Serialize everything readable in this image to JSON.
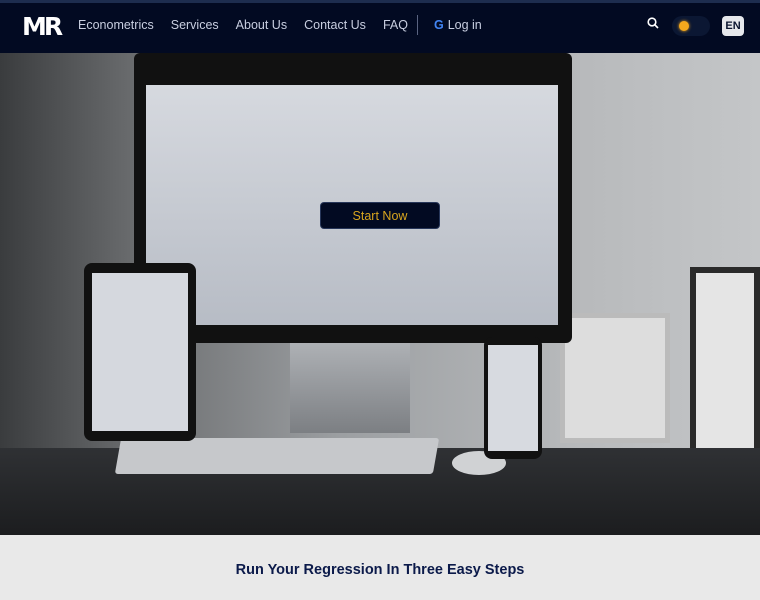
{
  "nav": {
    "logo": "MR",
    "links": [
      "Econometrics",
      "Services",
      "About Us",
      "Contact Us",
      "FAQ"
    ],
    "login_icon": "google-icon",
    "login_label": "Log in",
    "language": "EN"
  },
  "hero": {
    "cta_label": "Start Now",
    "accent_color": "#d8a51e",
    "nav_bg": "#020a22"
  },
  "section": {
    "heading": "Run Your Regression In Three Easy Steps"
  }
}
